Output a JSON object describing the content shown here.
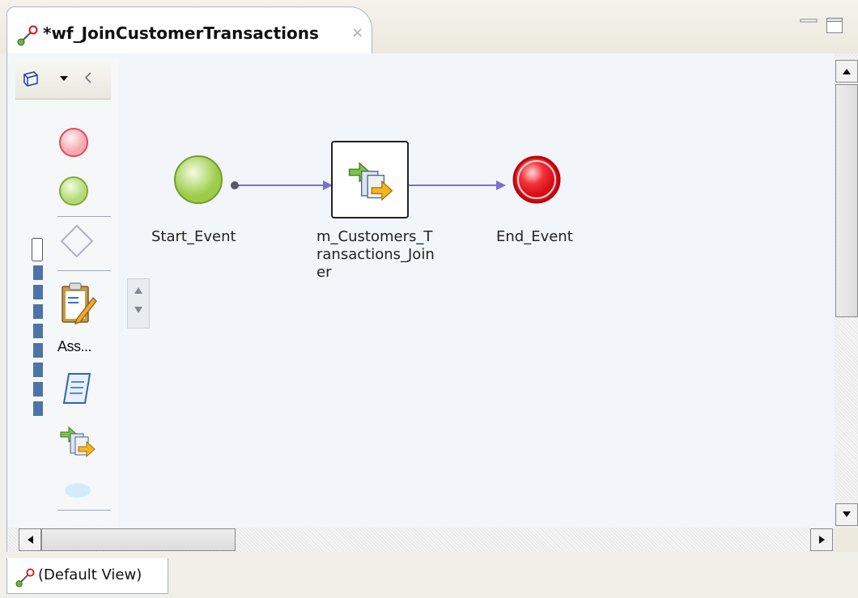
{
  "editor_tab": {
    "title": "*wf_JoinCustomerTransactions",
    "close_glyph": "×",
    "icon": "workflow-icon"
  },
  "palette": {
    "assignment_label": "Ass...",
    "items": [
      "end-event-icon",
      "start-event-icon",
      "exclusive-gateway-icon",
      "assignment-icon",
      "command-task-icon",
      "mapping-task-icon",
      "notification-task-icon"
    ]
  },
  "diagram": {
    "start_event": {
      "label": "Start_Event",
      "color": "#9ccc4a"
    },
    "mapping_task": {
      "label": "m_Customers_T\nransactions_Join\ner",
      "icon": "mapping-task-icon"
    },
    "end_event": {
      "label": "End_Event",
      "color": "#e8151b"
    },
    "link_color": "#7a72c8"
  },
  "bottom": {
    "view_label": "(Default View)"
  }
}
